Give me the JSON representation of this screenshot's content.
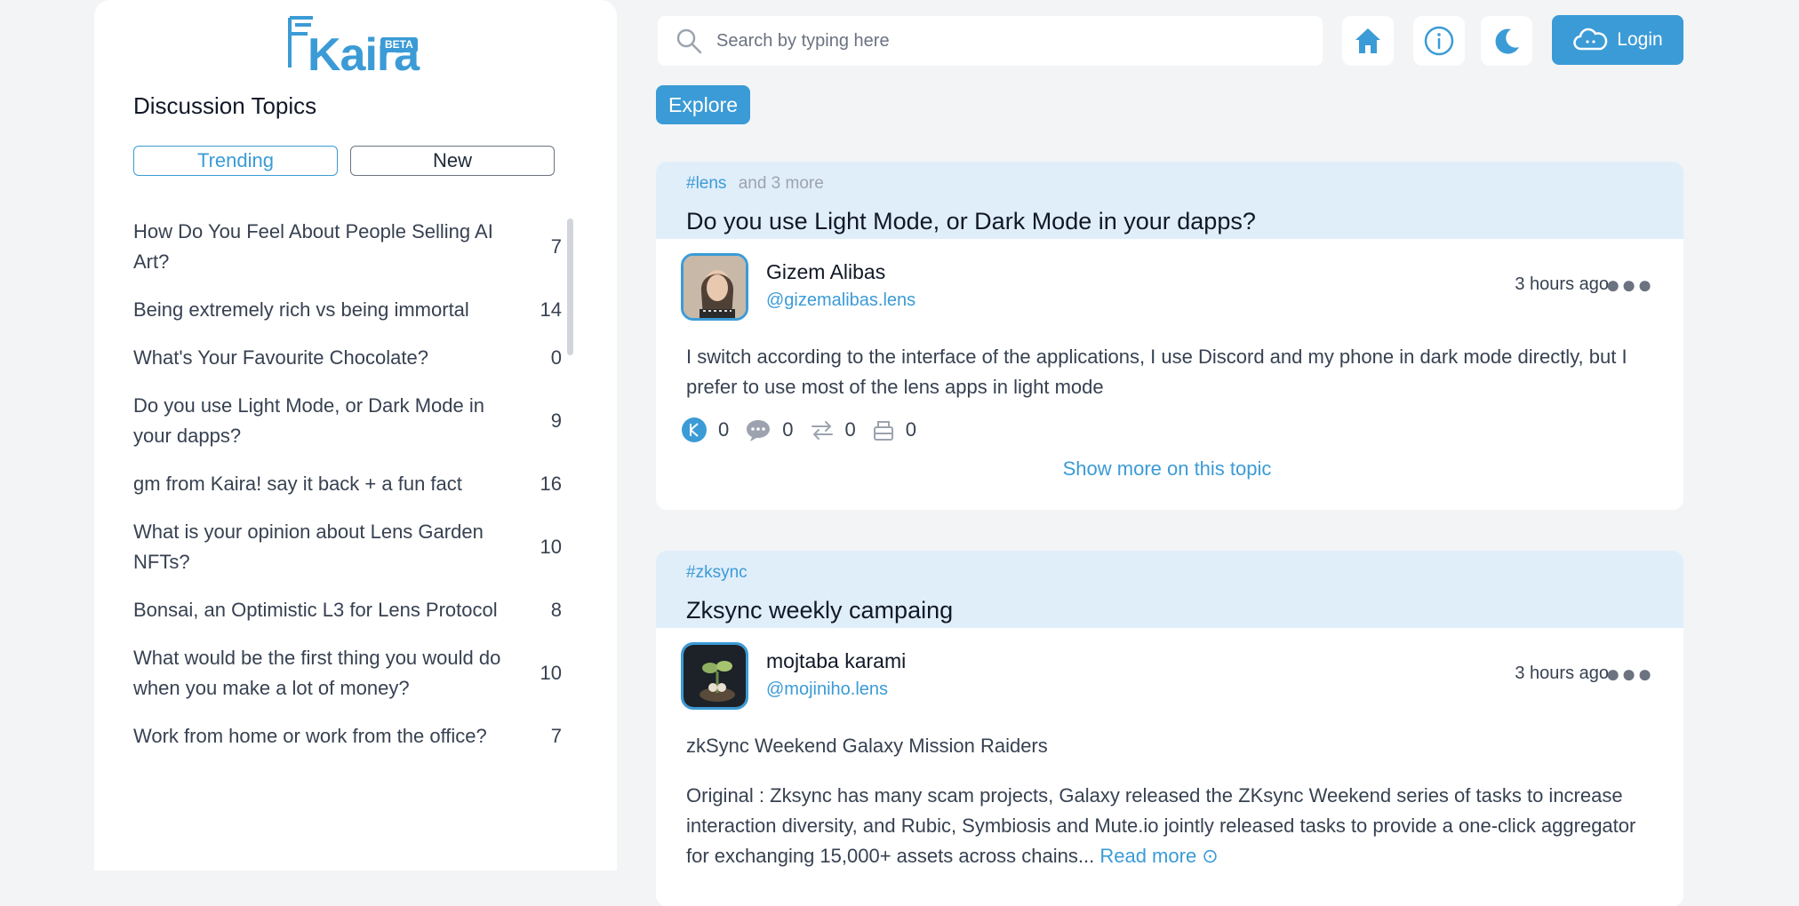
{
  "logo": {
    "word": "Kaira",
    "badge": "BETA"
  },
  "sidebar": {
    "title": "Discussion Topics",
    "tabs": {
      "trending": "Trending",
      "new": "New"
    },
    "topics": [
      {
        "title": "How Do You Feel About People Selling AI Art?",
        "count": "7"
      },
      {
        "title": "Being extremely rich vs being immortal",
        "count": "14"
      },
      {
        "title": "What's Your Favourite Chocolate?",
        "count": "0"
      },
      {
        "title": "Do you use Light Mode, or Dark Mode in your dapps?",
        "count": "9"
      },
      {
        "title": "gm from Kaira! say it back + a fun fact",
        "count": "16"
      },
      {
        "title": "What is your opinion about Lens Garden NFTs?",
        "count": "10"
      },
      {
        "title": "Bonsai, an Optimistic L3 for Lens Protocol",
        "count": "8"
      },
      {
        "title": "What would be the first thing you would do when you make a lot of money?",
        "count": "10"
      },
      {
        "title": "Work from home or work from the office?",
        "count": "7"
      }
    ]
  },
  "header": {
    "search_placeholder": "Search by typing here",
    "login_label": "Login",
    "explore_label": "Explore",
    "accent_color": "#3b9bd6"
  },
  "posts": [
    {
      "tag": "#lens",
      "tag_more": "and 3 more",
      "title": "Do you use Light Mode, or Dark Mode in your dapps?",
      "author": "Gizem Alibas",
      "handle": "@gizemalibas.lens",
      "time": "3 hours ago",
      "body": "I switch according to the interface of the applications, I use Discord and my phone in dark mode directly, but I prefer to use most of the lens apps in light mode",
      "stats": {
        "likes": "0",
        "comments": "0",
        "mirrors": "0",
        "collects": "0"
      },
      "show_more": "Show more on this topic"
    },
    {
      "tag": "#zksync",
      "title": "Zksync weekly campaing",
      "author": "mojtaba karami",
      "handle": "@mojiniho.lens",
      "time": "3 hours ago",
      "body_1": "zkSync Weekend Galaxy Mission Raiders",
      "body_2": "Original : Zksync has many scam projects, Galaxy released the ZKsync Weekend series of tasks to increase interaction diversity, and Rubic, Symbiosis and Mute.io jointly released tasks to provide a one-click aggregator for exchanging 15,000+ assets across chains...",
      "read_more": "Read more"
    }
  ]
}
